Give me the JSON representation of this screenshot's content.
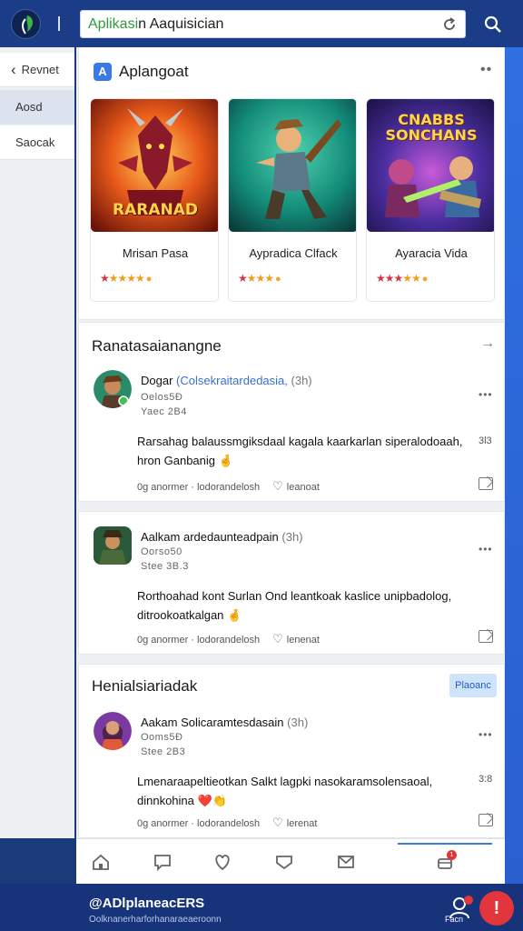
{
  "header": {
    "search_query_green": "Aplikasi",
    "search_query_rest": "n Aaquisician",
    "refresh_icon": "refresh-icon",
    "search_icon": "search-icon"
  },
  "sidebar": {
    "back_label": "Revnet",
    "items": [
      {
        "label": "Aosd"
      },
      {
        "label": "Saocak"
      }
    ]
  },
  "featured": {
    "title": "Aplangoat",
    "games": [
      {
        "name": "Mrisan Pasa",
        "art_text": "RARANAD"
      },
      {
        "name": "Aypradica Clfack",
        "art_text": ""
      },
      {
        "name": "Ayaracia Vida",
        "art_text": "CNABBS SONCHANS"
      }
    ]
  },
  "reviews": {
    "title": "Ranatasaianangne",
    "posts": [
      {
        "name": "Dogar",
        "link": "(Colsekraitardedasia,",
        "extra": "(3h)",
        "meta1": "Oelos5Đ",
        "meta2": "Yaec 2B4",
        "body": "Rarsahag balaussmgiksdaal kagala kaarkarlan siperalodoaah, hron Ganbanig 🤞",
        "count": "3l3",
        "foot_left": "0g anormer · lodorandelosh",
        "foot_right": "leanoat"
      },
      {
        "name": "Aalkam ardedaunteadpain",
        "link": "",
        "extra": "(3h)",
        "meta1": "Oorso50",
        "meta2": "Stee 3B.3",
        "body": "Rorthoahad kont Surlan Ond leantkoak kaslice unipbadolog, ditrookoatkalgan 🤞",
        "count": "",
        "foot_left": "0g anormer · lodorandelosh",
        "foot_right": "lenenat"
      }
    ]
  },
  "trending": {
    "title": "Henialsiariadak",
    "tag_label": "Plaoanc",
    "posts": [
      {
        "name": "Aakam Solicaramtesdasain",
        "link": "",
        "extra": "(3h)",
        "meta1": "Ooms5Ð",
        "meta2": "Stee 2B3",
        "body": "Lmenaraapeltieotkan Salkt lagpki nasokaramsolensaoal, dinnkohina ❤️👏",
        "count": "3:8",
        "foot_left": "0g anormer · lodorandelosh",
        "foot_right": "lerenat"
      }
    ]
  },
  "footer": {
    "title": "@ADlplaneacERS",
    "subtitle": "Oolknanerharforhanaraeaeroonn",
    "user_label": "Facn",
    "fab_label": "!"
  },
  "nav": {
    "badge": "1"
  }
}
